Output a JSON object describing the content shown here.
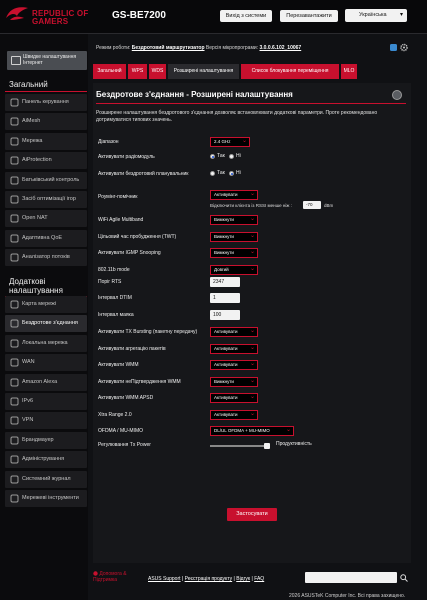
{
  "header": {
    "brand_line1": "REPUBLIC OF",
    "brand_line2": "GAMERS",
    "model": "GS-BE7200",
    "logout_label": "Вихід з системи",
    "reboot_label": "Перезавантажити",
    "language": "Українська"
  },
  "sidebar": {
    "quick_setup": "Швидке налаштування Інтернет",
    "general_title": "Загальний",
    "general_items": [
      "Панель керування",
      "AiMesh",
      "Мережа",
      "AiProtection",
      "Батьківський контроль",
      "Засіб оптимізації ігор",
      "Open NAT",
      "Адаптивна QoE",
      "Аналізатор потоків"
    ],
    "advanced_title": "Додаткові налаштування",
    "advanced_items": [
      "Карта мережі",
      "Бездротове з'єднання",
      "Локальна мережа",
      "WAN",
      "Amazon Alexa",
      "IPv6",
      "VPN",
      "Брандмауер",
      "Адміністрування",
      "Системний журнал",
      "Мережеві інструменти"
    ]
  },
  "modeline": {
    "mode_label": "Режим роботи:",
    "mode_value": "Бездротовий маршрутизатор",
    "fw_label": "Версія мікропрограми:",
    "fw_value": "3.0.0.6.102_10067"
  },
  "tabs": [
    "Загальний",
    "WPS",
    "WDS",
    "Розширені налаштування",
    "Список блокування переміщення",
    "MLO"
  ],
  "panel": {
    "title": "Бездротове з'єднання - Розширені налаштування",
    "description": "Розширене налаштування бездротового з'єднання дозволяє встановлювати додаткові параметри. Проте рекомендовано дотримуватися типових значень.",
    "band": {
      "label": "Діапазон",
      "value": "2.4 GHz"
    },
    "radio_enable": {
      "label": "Активувати радіомодуль",
      "yes": "Так",
      "no": "Ні",
      "selected": "yes"
    },
    "wireless_scheduler": {
      "label": "Активувати бездротовий планувальник",
      "yes": "Так",
      "no": "Ні",
      "selected": "no"
    },
    "roaming": {
      "label": "Роумінг-помічник",
      "value": "Активувати",
      "rssi_text": "Відключити клієнта із RSSI менше ніж :",
      "rssi_value": "-70",
      "rssi_unit": "dBm"
    },
    "settings": [
      {
        "label": "WiFi Agile Multiband",
        "value": "Вимкнути"
      },
      {
        "label": "Цільовий час пробудження (TWT)",
        "value": "Вимкнути"
      },
      {
        "label": "Активувати IGMP Snooping",
        "value": "Вимкнути"
      },
      {
        "label": "802.11b mode",
        "value": "Довгий"
      }
    ],
    "rts": {
      "label": "Поріг RTS",
      "value": "2347"
    },
    "dtim": {
      "label": "Інтервал DTIM",
      "value": "1"
    },
    "beacon": {
      "label": "Інтервал маяка",
      "value": "100"
    },
    "settings2": [
      {
        "label": "Активувати TX Bursting (пакетну передачу)",
        "value": "Активувати"
      },
      {
        "label": "Активувати агрегацію пакетів",
        "value": "Активувати"
      },
      {
        "label": "Активувати WMM",
        "value": "Активувати"
      },
      {
        "label": "Активувати неПідтвердження WMM",
        "value": "Вимкнути"
      },
      {
        "label": "Активувати WMM APSD",
        "value": "Активувати"
      },
      {
        "label": "Xtra Range 2.0",
        "value": "Активувати"
      }
    ],
    "ofdma": {
      "label": "OFDMA / MU-MIMO",
      "value": "DL/UL OFDMA + MU-MIMO"
    },
    "tx_power": {
      "label": "Регулювання Tx Power",
      "value_label": "Продуктивність",
      "level_percent": 100
    },
    "apply_label": "Застосувати"
  },
  "footer": {
    "help_label": "Допомога & Підтримка",
    "links": [
      "ASUS Support",
      "Реєстрація продукту",
      "Відгук",
      "FAQ"
    ],
    "copyright": "2026 ASUSTeK Computer Inc. Всі права захищено."
  }
}
